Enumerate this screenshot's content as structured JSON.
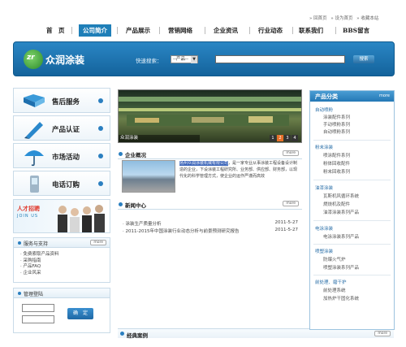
{
  "top_links": [
    "» 回首页",
    "» 设为首页",
    "» 收藏本站"
  ],
  "nav": {
    "items": [
      "首　页",
      "公司简介",
      "产品展示",
      "营销网络",
      "企业资讯",
      "行业动态",
      "联系我们",
      "BBS留言"
    ],
    "active_index": 1
  },
  "brand": {
    "logo_text": "zr",
    "name": "众润涂装",
    "colors": {
      "primary": "#1f7fb8",
      "accent": "#e8702a"
    }
  },
  "search": {
    "label": "快速搜索：",
    "select_value": "--产品--",
    "button_label": "搜索"
  },
  "side_menu": [
    {
      "label": "售后服务",
      "icon": "book-icon"
    },
    {
      "label": "产品认证",
      "icon": "pen-icon"
    },
    {
      "label": "市场活动",
      "icon": "umbrella-icon"
    },
    {
      "label": "电话订购",
      "icon": "phone-icon"
    }
  ],
  "recruit": {
    "title": "人才招聘",
    "subtitle": "JOIN US"
  },
  "service_box": {
    "title": "服务与支持",
    "more": "more",
    "items": [
      "· 免费索取产品资料",
      "· 采购指南",
      "· 产品FAQ",
      "· 企业风采"
    ]
  },
  "login_box": {
    "title": "管理登陆",
    "button_label": "确　定"
  },
  "slideshow": {
    "caption": "众润涂装",
    "pages": [
      "1",
      "2",
      "3",
      "4"
    ],
    "active_page": 2
  },
  "profile": {
    "title": "企业概况",
    "more": "more",
    "highlight": "扬州众润涂装机械有限公司",
    "text": "，是一家专业从事涂装工程设备设计制造的企业，下设涂装工程研究所、业务部、供应部、财务部，以现代化的科学管理方式，使企业的运作严谨而高效"
  },
  "news": {
    "title": "新闻中心",
    "more": "more",
    "items": [
      {
        "title": "· 涂装生产质量分析",
        "date": "2011-5-27"
      },
      {
        "title": "· 2011-2015年中国涂装行业动态分析与前景预测研究报告",
        "date": "2011-5-27"
      }
    ]
  },
  "cases": {
    "title": "经典案例",
    "more": "more"
  },
  "categories": {
    "title": "产品分类",
    "more": "more",
    "groups": [
      {
        "name": "自动喷粉",
        "items": [
          "涂装配件系列",
          "手动喷粉系列",
          "自动喷粉系列"
        ]
      },
      {
        "name": "粉末涂装",
        "items": [
          "喷涂配件系列",
          "粉体回收配件",
          "粉末回收系列"
        ]
      },
      {
        "name": "油漆涂装",
        "items": [
          "瓦斯机风循环系统",
          "燃烧机及配件",
          "油漆涂装系列产品"
        ]
      },
      {
        "name": "电泳涂装",
        "items": [
          "电泳涂装系列产品"
        ]
      },
      {
        "name": "喷塑涂装",
        "items": [
          "防爆火气炉",
          "喷塑涂装系列产品"
        ]
      },
      {
        "name": "前处理、磨干护",
        "items": [
          "前处理系统",
          "加热炉干固化系统"
        ]
      }
    ]
  }
}
